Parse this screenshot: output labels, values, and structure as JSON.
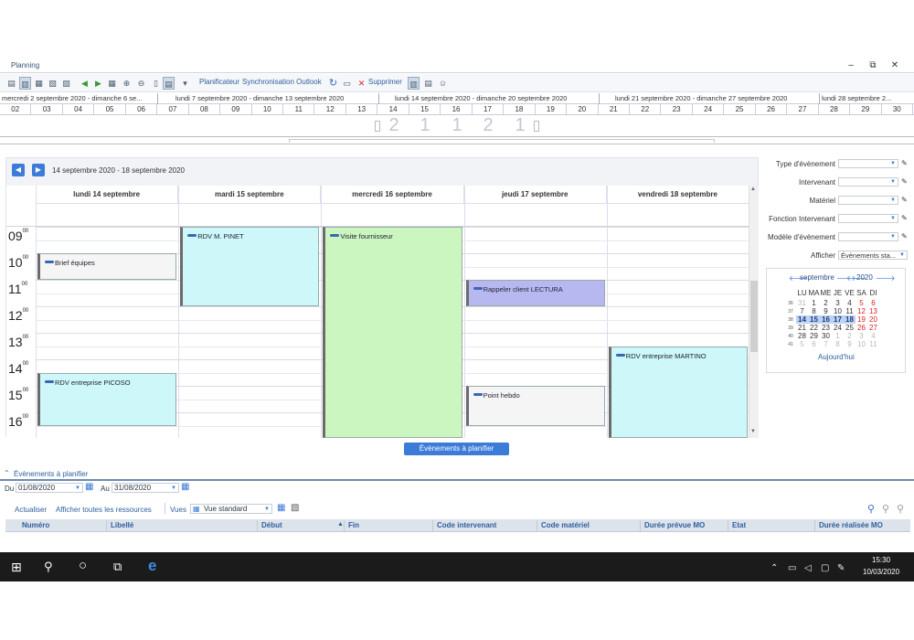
{
  "window": {
    "title": "Planning"
  },
  "toolbar": {
    "planificateur": "Planificateur",
    "sync_outlook": "Synchronisation Outlook",
    "supprimer": "Supprimer"
  },
  "timeline": {
    "weeks": [
      "mercredi 2 septembre 2020 - dimanche 6 se...",
      "lundi 7 septembre 2020 - dimanche 13 septembre 2020",
      "lundi 14 septembre 2020 - dimanche 20 septembre 2020",
      "lundi 21 septembre 2020 - dimanche 27 septembre 2020",
      "lundi 28 septembre 2..."
    ],
    "days": [
      "02",
      "03",
      "04",
      "05",
      "06",
      "07",
      "08",
      "09",
      "10",
      "11",
      "12",
      "13",
      "14",
      "15",
      "16",
      "17",
      "18",
      "19",
      "20",
      "21",
      "22",
      "23",
      "24",
      "25",
      "26",
      "27",
      "28",
      "29",
      "30"
    ],
    "counts": [
      "2",
      "1",
      "1",
      "2",
      "1"
    ]
  },
  "calendar": {
    "range": "14 septembre 2020 - 18 septembre 2020",
    "days": [
      "lundi 14 septembre",
      "mardi 15 septembre",
      "mercredi 16 septembre",
      "jeudi 17 septembre",
      "vendredi 18 septembre"
    ],
    "hours": [
      "09",
      "10",
      "11",
      "12",
      "13",
      "14",
      "15",
      "16"
    ],
    "hour_suffix": "00",
    "events": [
      {
        "label": "RDV M. PINET",
        "day": 1,
        "start": 9.0,
        "end": 12.0,
        "color": "#cdf7f8"
      },
      {
        "label": "Visite fournisseur",
        "day": 2,
        "start": 9.0,
        "end": 17.0,
        "color": "#ccf6c0"
      },
      {
        "label": "Brief équipes",
        "day": 0,
        "start": 10.0,
        "end": 11.0,
        "color": "#f5f5f5"
      },
      {
        "label": "Rappeler client LECTURA",
        "day": 3,
        "start": 11.0,
        "end": 12.0,
        "color": "#b8b8f0"
      },
      {
        "label": "RDV entreprise PICOSO",
        "day": 0,
        "start": 14.5,
        "end": 16.5,
        "color": "#cdf7f8"
      },
      {
        "label": "RDV entreprise MARTINO",
        "day": 4,
        "start": 13.5,
        "end": 17.0,
        "color": "#cdf7f8"
      },
      {
        "label": "Point hebdo",
        "day": 3,
        "start": 15.0,
        "end": 16.5,
        "color": "#f5f5f5"
      }
    ]
  },
  "plan_button": "Évènements à planifier",
  "filters": {
    "type": "Type d'évènement",
    "intervenant": "Intervenant",
    "materiel": "Matériel",
    "fonction": "Fonction Intervenant",
    "modele": "Modèle d'évènement",
    "afficher": "Afficher",
    "afficher_value": "Évènements sta..."
  },
  "minical": {
    "month": "septembre",
    "year": "2020",
    "dow": [
      "LU",
      "MA",
      "ME",
      "JE",
      "VE",
      "SA",
      "DI"
    ],
    "weeks": [
      {
        "no": "36",
        "days": [
          "31",
          "1",
          "2",
          "3",
          "4",
          "5",
          "6"
        ]
      },
      {
        "no": "37",
        "days": [
          "7",
          "8",
          "9",
          "10",
          "11",
          "12",
          "13"
        ]
      },
      {
        "no": "38",
        "days": [
          "14",
          "15",
          "16",
          "17",
          "18",
          "19",
          "20"
        ]
      },
      {
        "no": "39",
        "days": [
          "21",
          "22",
          "23",
          "24",
          "25",
          "26",
          "27"
        ]
      },
      {
        "no": "40",
        "days": [
          "28",
          "29",
          "30",
          "1",
          "2",
          "3",
          "4"
        ]
      },
      {
        "no": "41",
        "days": [
          "5",
          "6",
          "7",
          "8",
          "9",
          "10",
          "11"
        ]
      }
    ],
    "today": "Aujourd'hui"
  },
  "bottom": {
    "title": "Évènements à planifier",
    "du_label": "Du",
    "du_value": "01/08/2020",
    "au_label": "Au",
    "au_value": "31/08/2020",
    "actualiser": "Actualiser",
    "afficher_ressources": "Afficher toutes les ressources",
    "vues_label": "Vues",
    "vue_value": "Vue standard",
    "columns": [
      "Numéro",
      "Libellé",
      "Début",
      "Fin",
      "Code intervenant",
      "Code matériel",
      "Durée prévue MO",
      "Etat",
      "Durée réalisée MO"
    ]
  },
  "taskbar": {
    "time": "15:30",
    "date": "10/03/2020"
  }
}
